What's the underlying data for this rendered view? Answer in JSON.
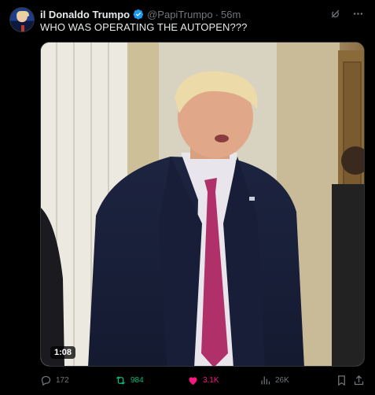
{
  "tweet": {
    "author_name": "il Donaldo Trumpo",
    "handle": "@PapiTrumpo",
    "separator": "·",
    "time": "56m",
    "text": "WHO WAS OPERATING THE AUTOPEN???",
    "verified": true,
    "media": {
      "type": "video",
      "duration": "1:08"
    },
    "actions": {
      "replies": "172",
      "reposts": "984",
      "likes": "3.1K",
      "views": "26K"
    }
  },
  "colors": {
    "background": "#000000",
    "text": "#e7e9ea",
    "muted": "#71767b",
    "verified": "#1d9bf0",
    "repost_active": "#00ba7c",
    "like_active": "#f91880"
  },
  "icons": {
    "grok": "grok-icon",
    "more": "more-icon",
    "reply": "reply-icon",
    "repost": "repost-icon",
    "like": "heart-icon",
    "views": "views-icon",
    "bookmark": "bookmark-icon",
    "share": "share-icon"
  }
}
